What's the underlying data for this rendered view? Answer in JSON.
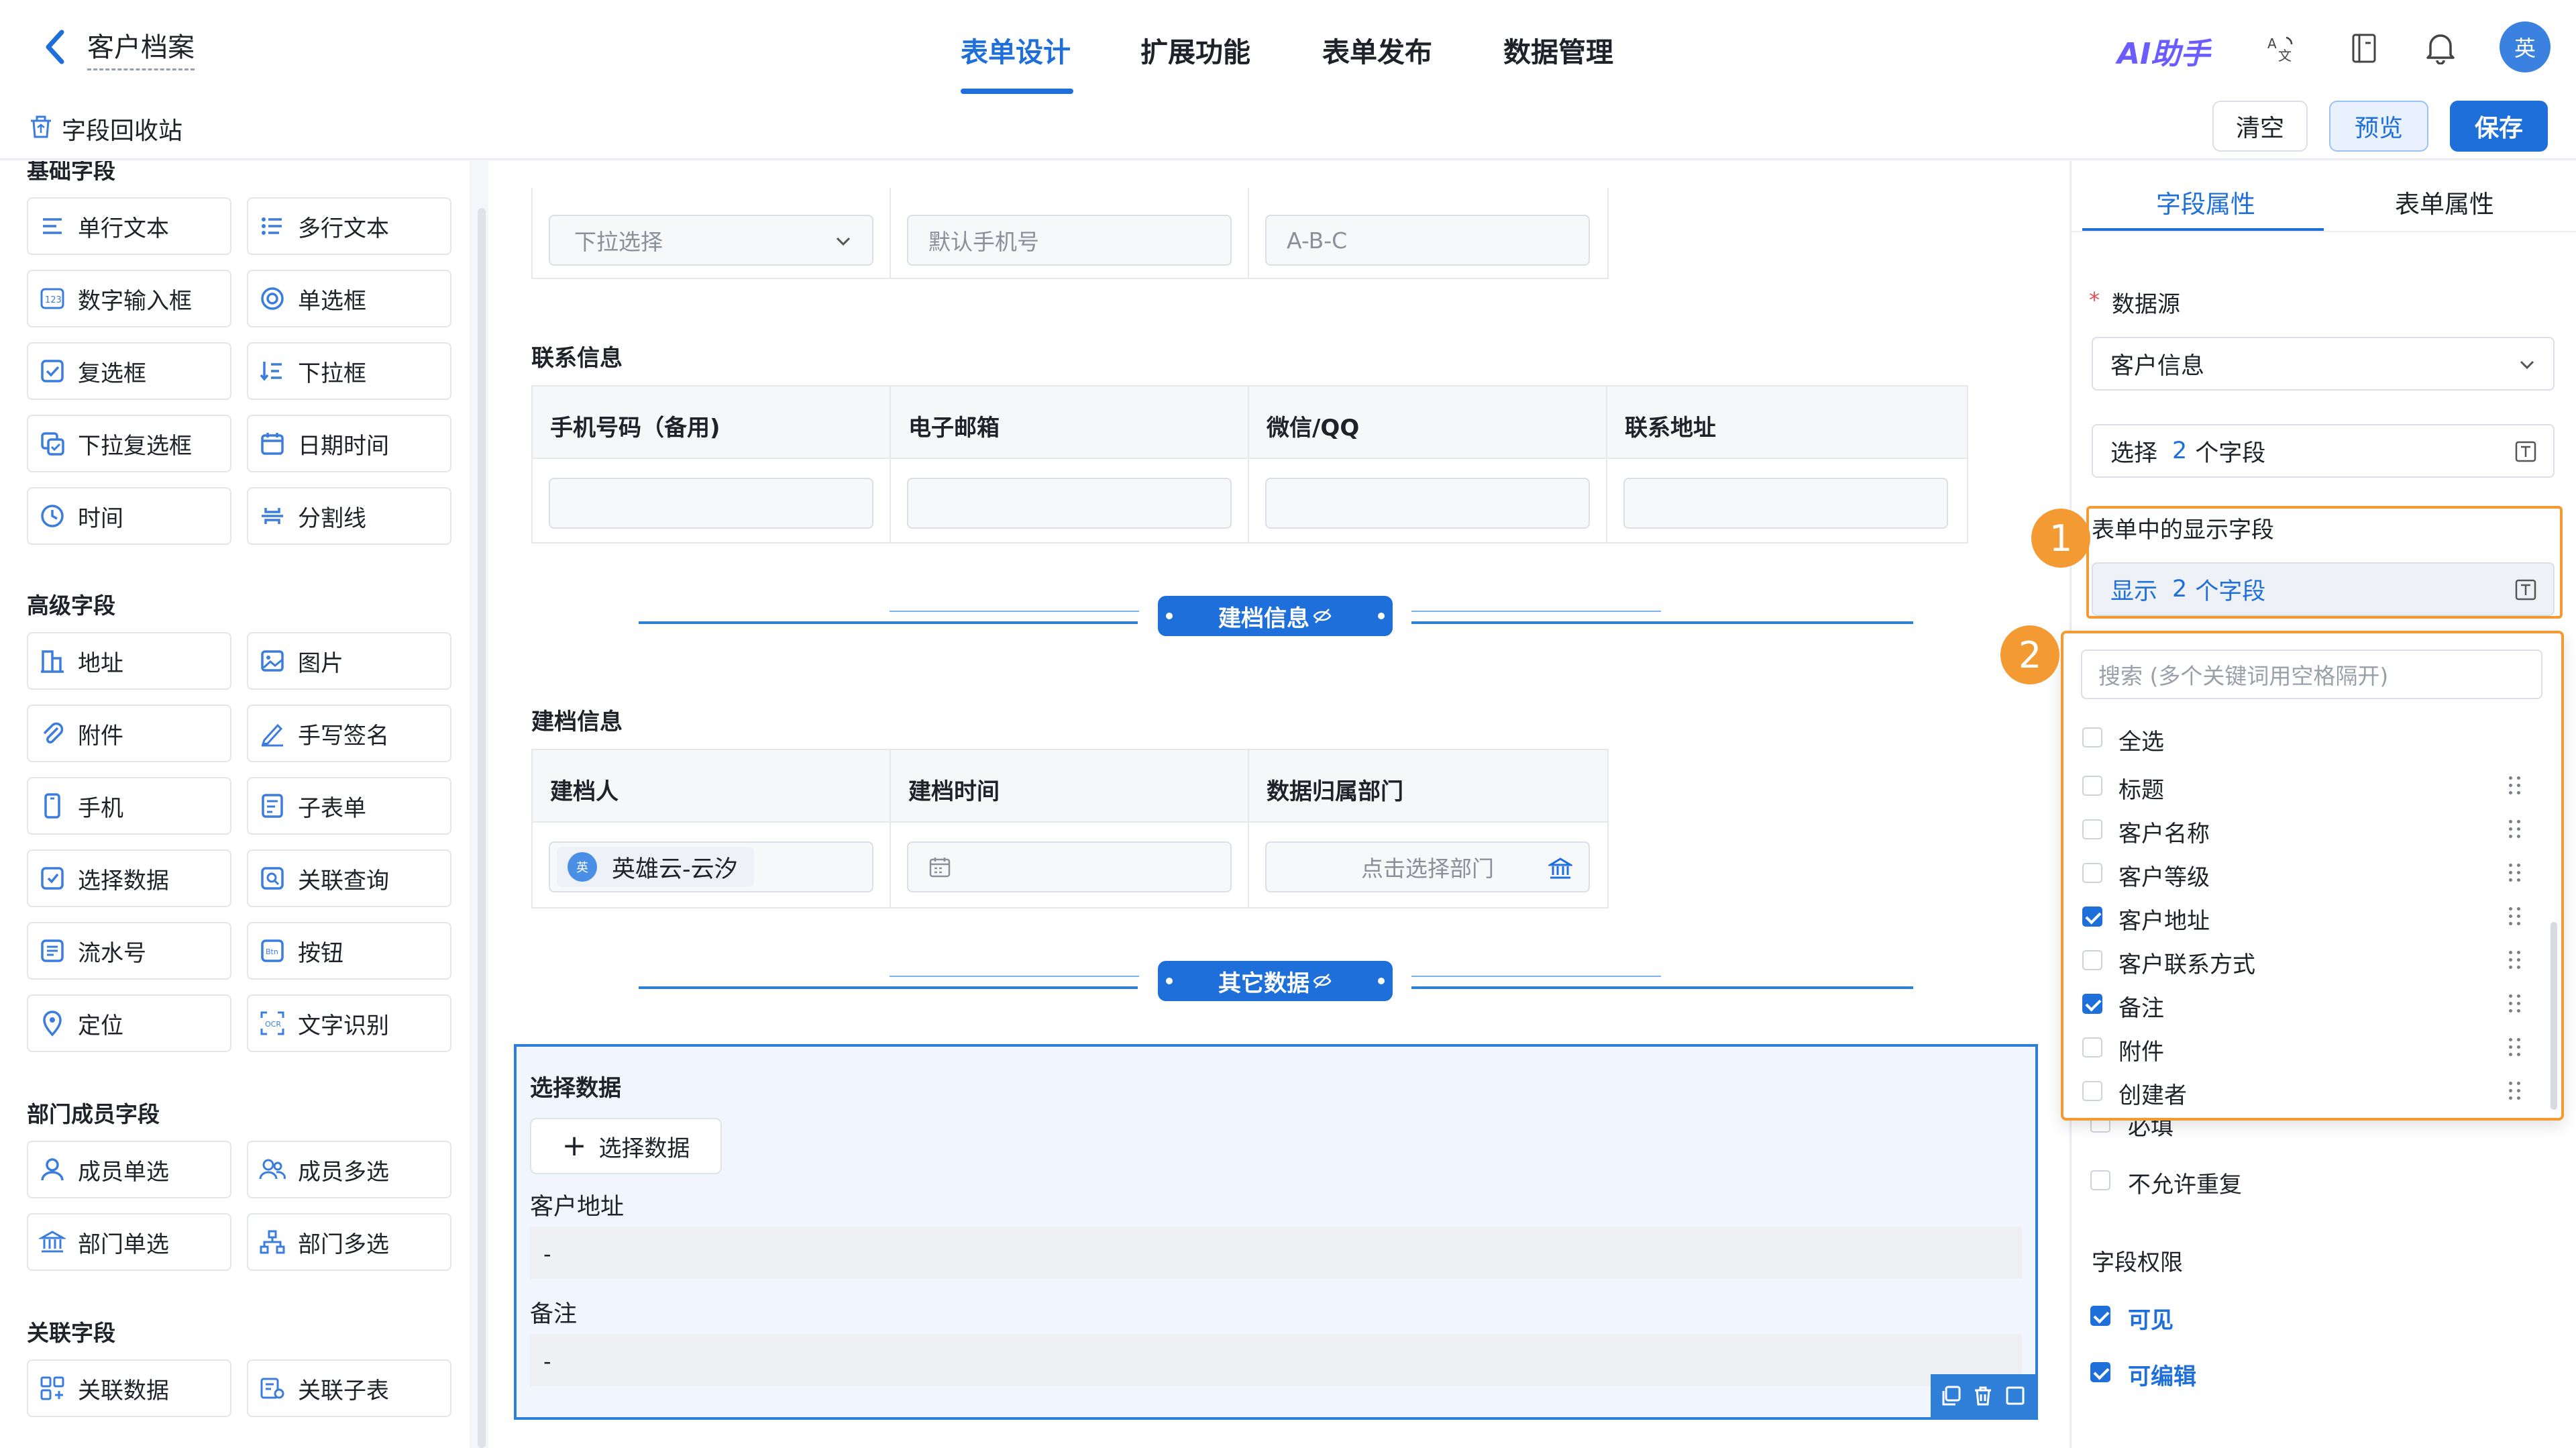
{
  "header": {
    "back_title": "客户档案",
    "tabs": [
      "表单设计",
      "扩展功能",
      "表单发布",
      "数据管理"
    ],
    "active_tab": 0,
    "ai_label": "AI助手",
    "avatar_text": "英"
  },
  "subbar": {
    "recycle_label": "字段回收站",
    "clear_label": "清空",
    "preview_label": "预览",
    "save_label": "保存"
  },
  "leftpanel": {
    "sections": {
      "basic": "基础字段",
      "advanced": "高级字段",
      "member": "部门成员字段",
      "relation": "关联字段"
    },
    "basic_fields": [
      "单行文本",
      "多行文本",
      "数字输入框",
      "单选框",
      "复选框",
      "下拉框",
      "下拉复选框",
      "日期时间",
      "时间",
      "分割线"
    ],
    "advanced_fields": [
      "地址",
      "图片",
      "附件",
      "手写签名",
      "手机",
      "子表单",
      "选择数据",
      "关联查询",
      "流水号",
      "按钮",
      "定位",
      "文字识别"
    ],
    "member_fields": [
      "成员单选",
      "成员多选",
      "部门单选",
      "部门多选"
    ],
    "relation_fields": [
      "关联数据",
      "关联子表"
    ]
  },
  "canvas": {
    "top_row": {
      "dropdown_placeholder": "下拉选择",
      "phone_placeholder": "默认手机号",
      "abc_placeholder": "A-B-C"
    },
    "contact": {
      "title": "联系信息",
      "headers": [
        "手机号码（备用)",
        "电子邮箱",
        "微信/QQ",
        "联系地址"
      ]
    },
    "divider1": "建档信息",
    "archive": {
      "title": "建档信息",
      "headers": [
        "建档人",
        "建档时间",
        "数据归属部门"
      ],
      "creator_avatar": "英",
      "creator": "英雄云-云汐",
      "dept_placeholder": "点击选择部门"
    },
    "divider2": "其它数据",
    "selected_block": {
      "title": "选择数据",
      "button": "选择数据",
      "field1_label": "客户地址",
      "field1_value": "-",
      "field2_label": "备注",
      "field2_value": "-"
    }
  },
  "rightpanel": {
    "tabs": [
      "字段属性",
      "表单属性"
    ],
    "active_tab": 0,
    "datasource_required": "*",
    "datasource_label": "数据源",
    "datasource_value": "客户信息",
    "select_fields_prefix": "选择",
    "select_fields_count": "2",
    "select_fields_suffix": "个字段",
    "display_label": "表单中的显示字段",
    "display_prefix": "显示",
    "display_count": "2",
    "display_suffix": "个字段",
    "search_placeholder": "搜索 (多个关键词用空格隔开)",
    "select_all": "全选",
    "options": [
      {
        "label": "标题",
        "checked": false
      },
      {
        "label": "客户名称",
        "checked": false
      },
      {
        "label": "客户等级",
        "checked": false
      },
      {
        "label": "客户地址",
        "checked": true
      },
      {
        "label": "客户联系方式",
        "checked": false
      },
      {
        "label": "备注",
        "checked": true
      },
      {
        "label": "附件",
        "checked": false
      },
      {
        "label": "创建者",
        "checked": false
      }
    ],
    "required_label": "必填",
    "unique_label": "不允许重复",
    "permission_title": "字段权限",
    "visible_label": "可见",
    "editable_label": "可编辑",
    "badge1": "1",
    "badge2": "2"
  },
  "colors": {
    "primary": "#1e6fd9",
    "highlight": "#f39a32",
    "ai_gradient_start": "#7b5cff",
    "ai_gradient_end": "#2f8cff"
  }
}
